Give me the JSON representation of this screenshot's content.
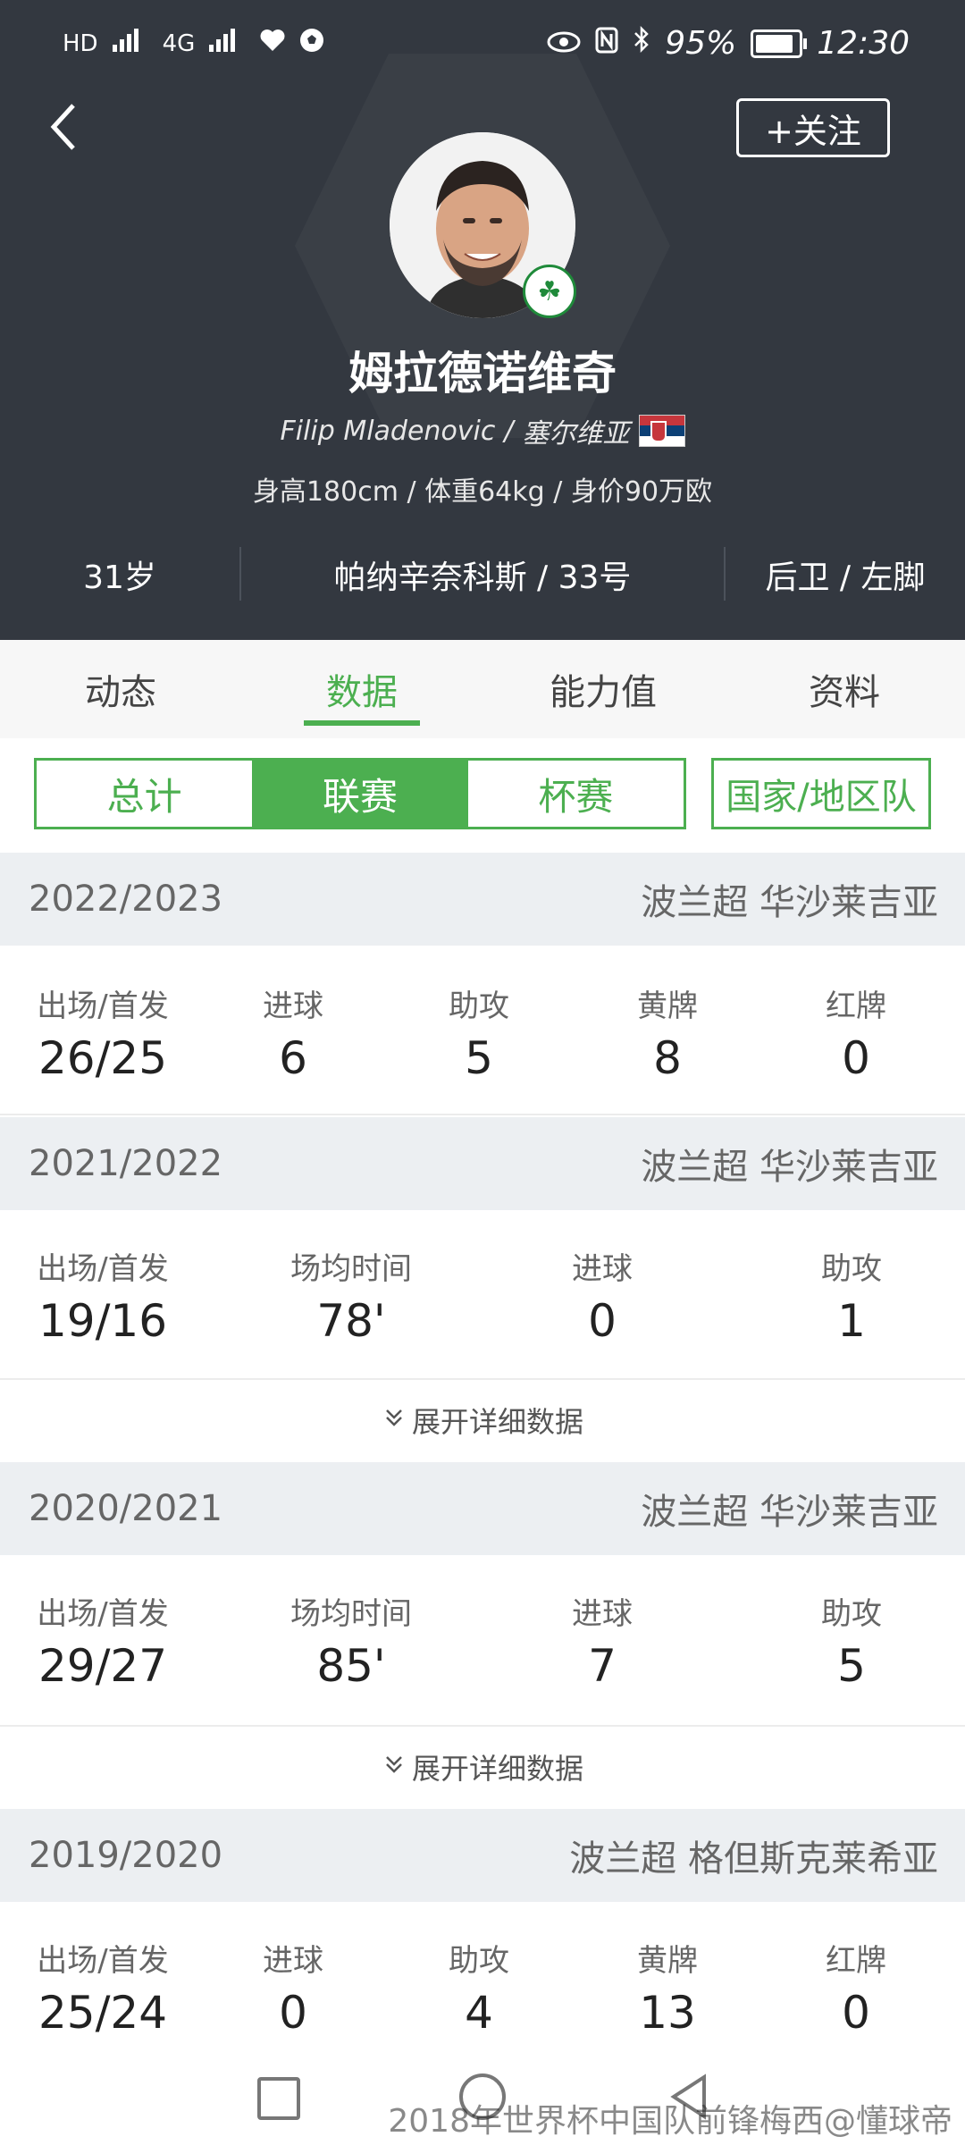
{
  "status": {
    "left_icons": [
      "HD",
      "4G",
      "4G",
      "heart-icon",
      "soccer-icon"
    ],
    "battery": "95%",
    "time": "12:30",
    "right_icons": [
      "eye-icon",
      "nfc-icon",
      "bluetooth-icon",
      "battery-icon"
    ],
    "battery_level": 0.95
  },
  "header": {
    "follow_label": "+关注",
    "name": "姆拉德诺维奇",
    "english_name": "Filip Mladenovic",
    "nationality": "塞尔维亚",
    "body_info": "身高180cm / 体重64kg / 身价90万欧",
    "age": "31岁",
    "club_number": "帕纳辛奈科斯 / 33号",
    "position_foot": "后卫 / 左脚"
  },
  "tabs": [
    "动态",
    "数据",
    "能力值",
    "资料"
  ],
  "active_tab": "数据",
  "filters": [
    "总计",
    "联赛",
    "杯赛"
  ],
  "active_filter": "联赛",
  "country_filter": "国家/地区队",
  "seasons": [
    {
      "year": "2022/2023",
      "league": "波兰超 华沙莱吉亚",
      "stats": [
        {
          "label": "出场/首发",
          "value": "26/25"
        },
        {
          "label": "进球",
          "value": "6"
        },
        {
          "label": "助攻",
          "value": "5"
        },
        {
          "label": "黄牌",
          "value": "8"
        },
        {
          "label": "红牌",
          "value": "0"
        }
      ]
    },
    {
      "year": "2021/2022",
      "league": "波兰超 华沙莱吉亚",
      "stats": [
        {
          "label": "出场/首发",
          "value": "19/16"
        },
        {
          "label": "场均时间",
          "value": "78'"
        },
        {
          "label": "进球",
          "value": "0"
        },
        {
          "label": "助攻",
          "value": "1"
        }
      ],
      "expand_label": "展开详细数据"
    },
    {
      "year": "2020/2021",
      "league": "波兰超 华沙莱吉亚",
      "stats": [
        {
          "label": "出场/首发",
          "value": "29/27"
        },
        {
          "label": "场均时间",
          "value": "85'"
        },
        {
          "label": "进球",
          "value": "7"
        },
        {
          "label": "助攻",
          "value": "5"
        }
      ],
      "expand_label": "展开详细数据"
    },
    {
      "year": "2019/2020",
      "league": "波兰超 格但斯克莱希亚",
      "stats": [
        {
          "label": "出场/首发",
          "value": "25/24"
        },
        {
          "label": "进球",
          "value": "0"
        },
        {
          "label": "助攻",
          "value": "4"
        },
        {
          "label": "黄牌",
          "value": "13"
        },
        {
          "label": "红牌",
          "value": "0"
        }
      ]
    }
  ],
  "watermark": "2018年世界杯中国队前锋梅西@懂球帝",
  "colors": {
    "header_bg": "#333840",
    "accent": "#4caf50",
    "section_bg": "#eceff2"
  }
}
